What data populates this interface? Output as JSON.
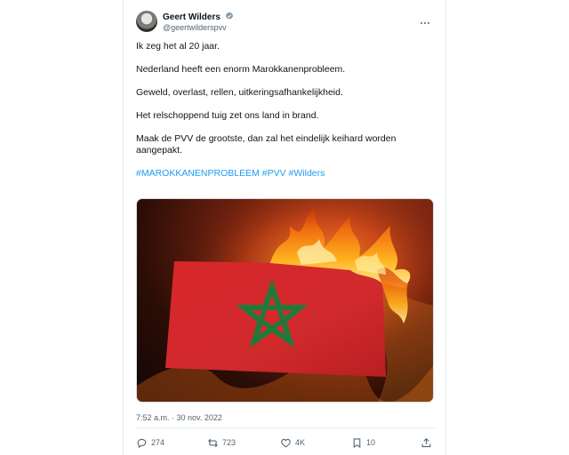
{
  "tweet": {
    "author_name": "Geert Wilders",
    "author_handle": "@geertwilderspvv",
    "paragraphs": [
      "Ik zeg het al 20 jaar.",
      "Nederland heeft een enorm Marokkanenprobleem.",
      "Geweld, overlast, rellen, uitkeringsafhankelijkheid.",
      "Het relschoppend tuig zet ons land in brand.",
      "Maak de PVV de grootste, dan zal het eindelijk keihard worden\naangepakt."
    ],
    "hashtags": "#MAROKKANENPROBLEEM #PVV #Wilders",
    "timestamp": "7:52 a.m. · 30 nov. 2022"
  },
  "actions": {
    "replies": "274",
    "reposts": "723",
    "likes": "4K",
    "views": "10"
  },
  "colors": {
    "link": "#1d9bf0",
    "verified": "#829aab",
    "flag_red": "#d8272b",
    "flag_star": "#1f7a3a"
  },
  "icons": [
    "verified-icon",
    "more-options-icon",
    "reply-icon",
    "repost-icon",
    "like-icon",
    "bookmark-icon",
    "share-icon"
  ]
}
